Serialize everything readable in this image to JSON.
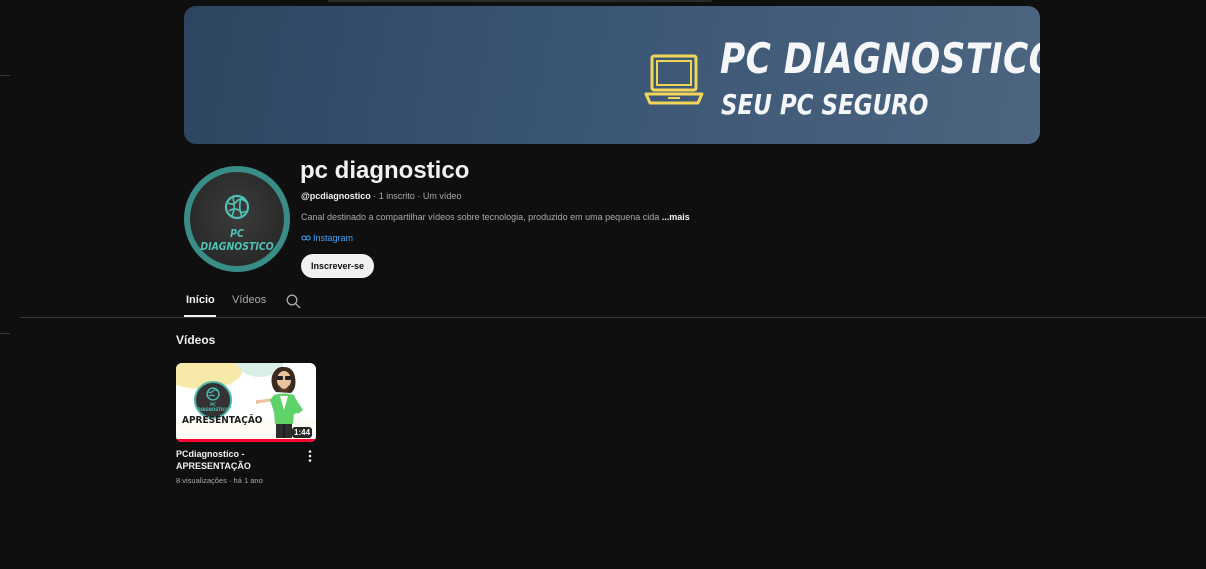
{
  "banner": {
    "title": "PC DIAGNOSTICO",
    "subtitle": "SEU PC SEGURO"
  },
  "avatar": {
    "text": "PC DIAGNOSTICO"
  },
  "channel": {
    "name": "pc diagnostico",
    "handle": "@pcdiagnostico",
    "subscribers": "1 inscrito",
    "videos": "Um vídeo",
    "description": "Canal destinado a compartilhar vídeos sobre tecnologia, produzido em uma pequena cida",
    "more_label": "...mais",
    "link_label": "Instagram",
    "subscribe_label": "Inscrever-se"
  },
  "tabs": [
    {
      "label": "Início",
      "active": true
    },
    {
      "label": "Vídeos",
      "active": false
    }
  ],
  "section": {
    "title": "Vídeos"
  },
  "videos": [
    {
      "title": "PCdiagnostico - APRESENTAÇÃO",
      "thumbnail_text": "APRESENTAÇÃO",
      "thumbnail_logo_text": "PC DIAGNOSTICO",
      "duration": "1:44",
      "views": "8 visualizações",
      "age": "há 1 ano"
    }
  ],
  "colors": {
    "background": "#0f0f0f",
    "accent_teal": "#4ec3b6",
    "banner_icon": "#f1d65a",
    "link": "#3ea6ff",
    "progress": "#ff0033"
  },
  "icons": [
    "laptop-icon",
    "globe-icon",
    "link-icon",
    "search-icon",
    "more-vert-icon"
  ]
}
